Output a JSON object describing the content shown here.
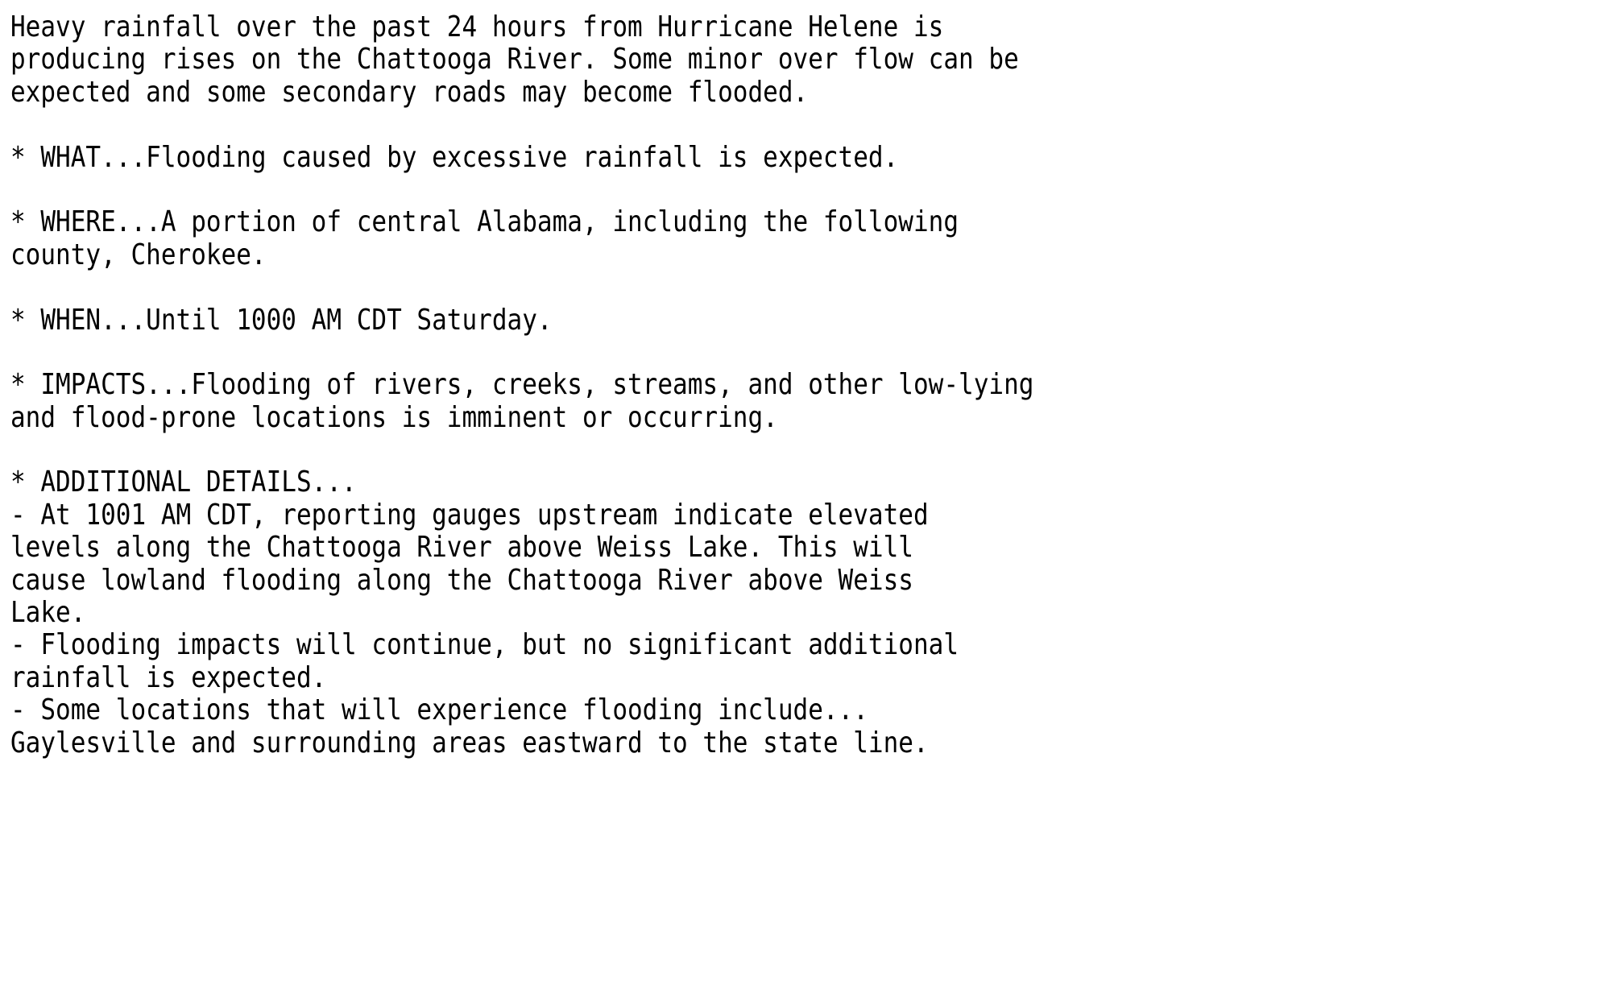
{
  "document": {
    "type": "nws-flood-warning-statement",
    "background_color": "#ffffff",
    "text_color": "#000000",
    "lines": [
      "Heavy rainfall over the past 24 hours from Hurricane Helene is",
      "producing rises on the Chattooga River. Some minor over flow can be",
      "expected and some secondary roads may become flooded.",
      "",
      "* WHAT...Flooding caused by excessive rainfall is expected.",
      "",
      "* WHERE...A portion of central Alabama, including the following",
      "county, Cherokee.",
      "",
      "* WHEN...Until 1000 AM CDT Saturday.",
      "",
      "* IMPACTS...Flooding of rivers, creeks, streams, and other low-lying",
      "and flood-prone locations is imminent or occurring.",
      "",
      "* ADDITIONAL DETAILS...",
      "- At 1001 AM CDT, reporting gauges upstream indicate elevated",
      "levels along the Chattooga River above Weiss Lake. This will",
      "cause lowland flooding along the Chattooga River above Weiss",
      "Lake.",
      "- Flooding impacts will continue, but no significant additional",
      "rainfall is expected.",
      "- Some locations that will experience flooding include...",
      "Gaylesville and surrounding areas eastward to the state line."
    ],
    "sections": {
      "preamble": {
        "text": "Heavy rainfall over the past 24 hours from Hurricane Helene is producing rises on the Chattooga River. Some minor over flow can be expected and some secondary roads may become flooded."
      },
      "what": {
        "label": "* WHAT...",
        "text": "Flooding caused by excessive rainfall is expected."
      },
      "where": {
        "label": "* WHERE...",
        "text": "A portion of central Alabama, including the following county, Cherokee."
      },
      "when": {
        "label": "* WHEN...",
        "text": "Until 1000 AM CDT Saturday."
      },
      "impacts": {
        "label": "* IMPACTS...",
        "text": "Flooding of rivers, creeks, streams, and other low-lying and flood-prone locations is imminent or occurring."
      },
      "additional_details": {
        "label": "* ADDITIONAL DETAILS...",
        "bullets": [
          "- At 1001 AM CDT, reporting gauges upstream indicate elevated levels along the Chattooga River above Weiss Lake. This will cause lowland flooding along the Chattooga River above Weiss Lake.",
          "- Flooding impacts will continue, but no significant additional rainfall is expected.",
          "- Some locations that will experience flooding include... Gaylesville and surrounding areas eastward to the state line."
        ]
      }
    },
    "key_values": {
      "hazard_source": "Hurricane Helene",
      "river": "Chattooga River",
      "lake": "Weiss Lake",
      "state": "Alabama",
      "county": "Cherokee",
      "location": "Gaylesville",
      "duration_hours": "24",
      "expires": "1000 AM CDT Saturday",
      "observation_time": "1001 AM CDT"
    }
  }
}
